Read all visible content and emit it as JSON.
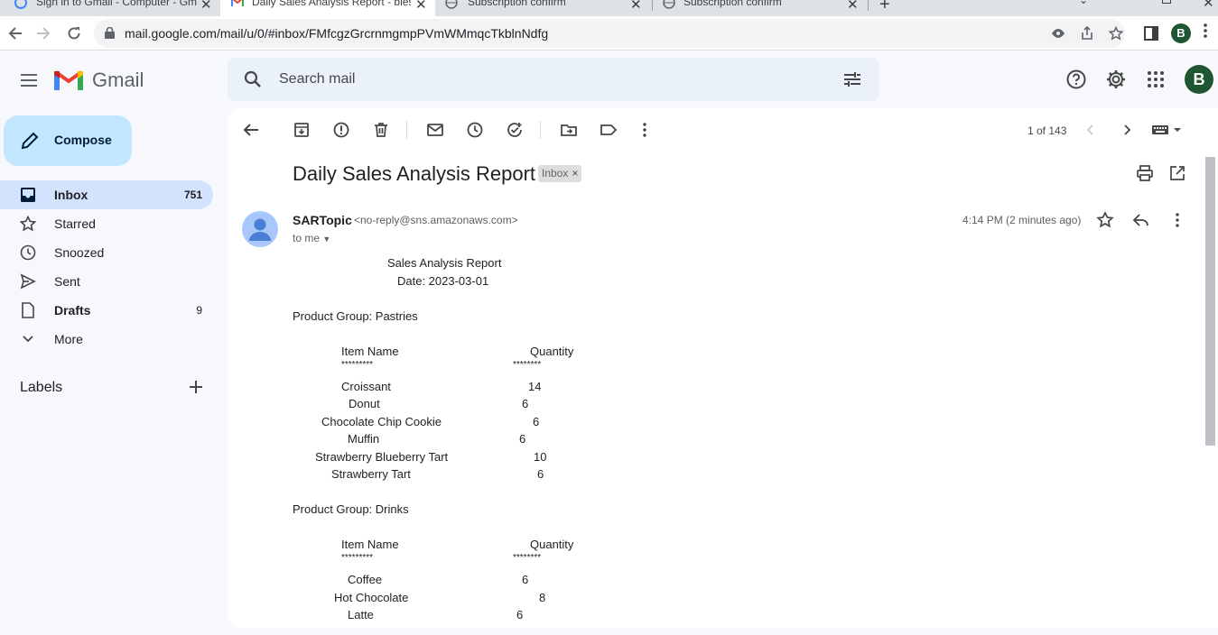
{
  "browser": {
    "tabs": [
      {
        "label": "Sign in to Gmail - Computer - Gm",
        "active": false
      },
      {
        "label": "Daily Sales Analysis Report - bles",
        "active": true
      },
      {
        "label": "Subscription confirm",
        "active": false
      },
      {
        "label": "Subscription confirm",
        "active": false
      }
    ],
    "url": "mail.google.com/mail/u/0/#inbox/FMfcgzGrcrnmgmpPVmWMmqcTkblnNdfg",
    "profile_initial": "B"
  },
  "gmail": {
    "logo_text": "Gmail",
    "search_placeholder": "Search mail",
    "account_initial": "B"
  },
  "sidebar": {
    "compose_label": "Compose",
    "items": [
      {
        "label": "Inbox",
        "count": "751",
        "icon": "inbox-icon",
        "active": true
      },
      {
        "label": "Starred",
        "count": "",
        "icon": "star-icon",
        "active": false
      },
      {
        "label": "Snoozed",
        "count": "",
        "icon": "clock-icon",
        "active": false
      },
      {
        "label": "Sent",
        "count": "",
        "icon": "send-icon",
        "active": false
      },
      {
        "label": "Drafts",
        "count": "9",
        "icon": "draft-icon",
        "active": false
      },
      {
        "label": "More",
        "count": "",
        "icon": "chevron-down-icon",
        "active": false
      }
    ],
    "labels_heading": "Labels"
  },
  "toolbar": {
    "pager": "1 of 143"
  },
  "message": {
    "subject": "Daily Sales Analysis Report",
    "label_chip": "Inbox",
    "sender_name": "SARTopic",
    "sender_email": "<no-reply@sns.amazonaws.com>",
    "to_line": "to me",
    "time": "4:14 PM (2 minutes ago)",
    "body": {
      "title": "Sales Analysis Report",
      "date": "Date: 2023-03-01",
      "groups": [
        {
          "heading": "Product Group: Pastries",
          "col_item": "Item Name",
          "col_qty": "Quantity",
          "sep_item": "*********",
          "sep_qty": "********",
          "rows": [
            {
              "item": "Croissant",
              "qty": "14"
            },
            {
              "item": "Donut",
              "qty": "6"
            },
            {
              "item": "Chocolate Chip Cookie",
              "qty": "6"
            },
            {
              "item": "Muffin",
              "qty": "6"
            },
            {
              "item": "Strawberry Blueberry Tart",
              "qty": "10"
            },
            {
              "item": "Strawberry Tart",
              "qty": "6"
            }
          ]
        },
        {
          "heading": "Product Group: Drinks",
          "col_item": "Item Name",
          "col_qty": "Quantity",
          "sep_item": "*********",
          "sep_qty": "********",
          "rows": [
            {
              "item": "Coffee",
              "qty": "6"
            },
            {
              "item": "Hot Chocolate",
              "qty": "8"
            },
            {
              "item": "Latte",
              "qty": "6"
            }
          ]
        }
      ]
    }
  }
}
